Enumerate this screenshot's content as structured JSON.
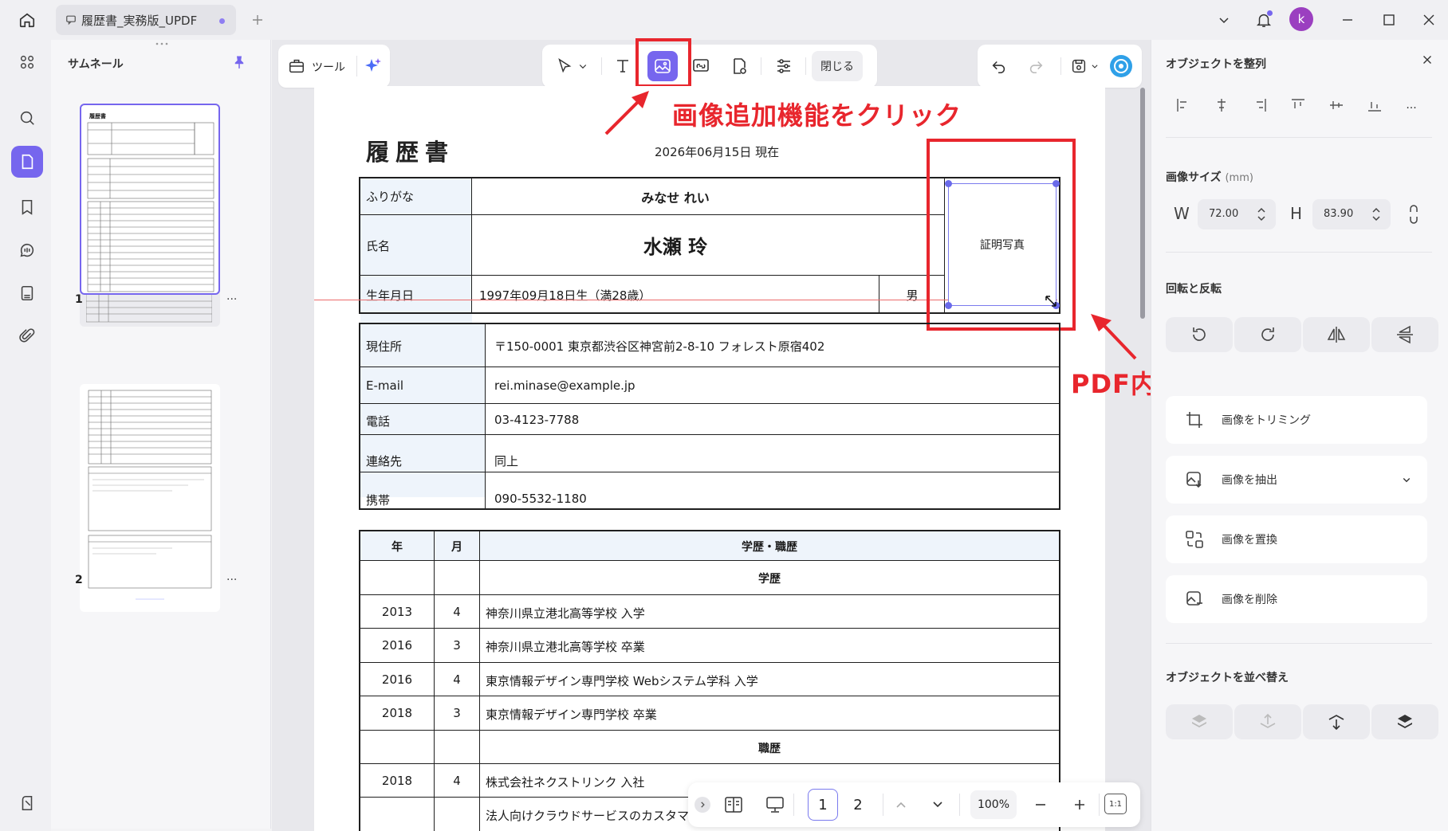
{
  "window": {
    "tab_title": "履歴書_実務版_UPDF",
    "user_initial": "k"
  },
  "toolbar": {
    "tools_label": "ツール",
    "close_label": "閉じる"
  },
  "thumbnails": {
    "title": "サムネール",
    "pages": [
      "1",
      "2"
    ],
    "more": "..."
  },
  "document": {
    "title": "履歴書",
    "date_line": "2026年06月15日 現在",
    "photo_label": "証明写真",
    "rows": [
      {
        "label": "ふりがな",
        "value": "みなせ れい"
      },
      {
        "label": "氏名",
        "value": "水瀬 玲"
      },
      {
        "label": "生年月日",
        "value": "1997年09月18日生（満28歳）",
        "gender": "男"
      }
    ],
    "contact": [
      {
        "label": "現住所",
        "value": "〒150-0001 東京都渋谷区神宮前2-8-10 フォレスト原宿402"
      },
      {
        "label": "E-mail",
        "value": "rei.minase@example.jp"
      },
      {
        "label": "電話",
        "value": "03-4123-7788"
      },
      {
        "label": "連絡先",
        "value": "同上"
      },
      {
        "label": "携帯",
        "value": "090-5532-1180"
      }
    ],
    "history_headers": [
      "年",
      "月",
      "学歴・職歴"
    ],
    "history_rows": [
      {
        "year": "",
        "month": "",
        "text": "学歴",
        "center": true
      },
      {
        "year": "2013",
        "month": "4",
        "text": "神奈川県立港北高等学校 入学"
      },
      {
        "year": "2016",
        "month": "3",
        "text": "神奈川県立港北高等学校 卒業"
      },
      {
        "year": "2016",
        "month": "4",
        "text": "東京情報デザイン専門学校 Webシステム学科 入学"
      },
      {
        "year": "2018",
        "month": "3",
        "text": "東京情報デザイン専門学校 卒業"
      },
      {
        "year": "",
        "month": "",
        "text": "職歴",
        "center": true
      },
      {
        "year": "2018",
        "month": "4",
        "text": "株式会社ネクストリンク 入社"
      },
      {
        "year": "",
        "month": "",
        "text": "法人向けクラウドサービスのカスタマー"
      }
    ]
  },
  "annotations": {
    "click_text": "画像追加機能をクリック",
    "place_text": "PDF内に配置"
  },
  "pager": {
    "pages": [
      "1",
      "2"
    ],
    "zoom": "100%",
    "fit": "1:1"
  },
  "right_panel": {
    "align_title": "オブジェクトを整列",
    "size_title": "画像サイズ",
    "size_unit": "(mm)",
    "w_label": "W",
    "w_value": "72.00",
    "h_label": "H",
    "h_value": "83.90",
    "rotate_title": "回転と反転",
    "actions": [
      "画像をトリミング",
      "画像を抽出",
      "画像を置換",
      "画像を削除"
    ],
    "order_title": "オブジェクトを並べ替え",
    "more": "..."
  },
  "colors": {
    "accent": "#7666ee",
    "annotation_red": "#e8262d",
    "header_cell": "#eef4fb"
  }
}
